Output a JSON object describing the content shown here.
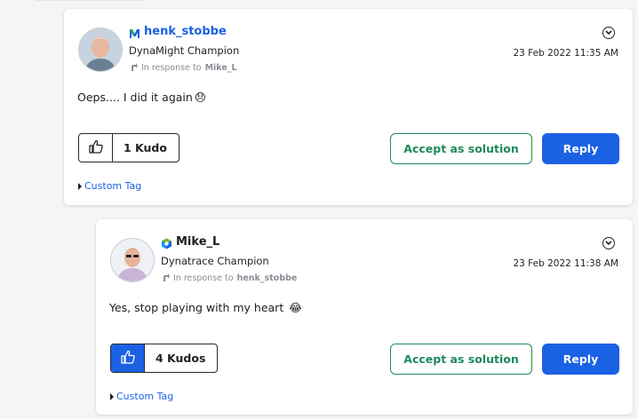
{
  "posts": [
    {
      "author": "henk_stobbe",
      "rank_icon": "dynamight-rank-icon",
      "rank": "DynaMight Champion",
      "in_response_prefix": "In response to",
      "in_response_to": "Mike_L",
      "date": "23 Feb 2022 11:35 AM",
      "body": "Oeps.... I did it again",
      "body_emoji": "😞",
      "kudos": "1 Kudo",
      "kudo_active": false,
      "accept_label": "Accept as solution",
      "reply_label": "Reply",
      "tag_label": "Custom Tag"
    },
    {
      "author": "Mike_L",
      "rank_icon": "dynatrace-rank-icon",
      "rank": "Dynatrace Champion",
      "in_response_prefix": "In response to",
      "in_response_to": "henk_stobbe",
      "date": "23 Feb 2022 11:38 AM",
      "body": "Yes, stop playing with my heart",
      "body_emoji": "😂",
      "kudos": "4 Kudos",
      "kudo_active": true,
      "accept_label": "Accept as solution",
      "reply_label": "Reply",
      "tag_label": "Custom Tag"
    }
  ],
  "colors": {
    "accent_blue": "#1b61e4",
    "accept_green": "#1f8a5b"
  }
}
